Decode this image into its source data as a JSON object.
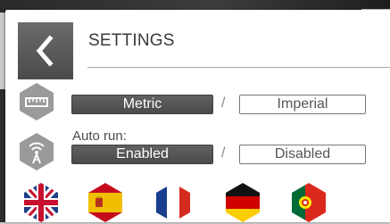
{
  "header": {
    "title": "SETTINGS",
    "back_icon": "chevron-left-icon"
  },
  "units": {
    "icon": "ruler-icon",
    "options": [
      "Metric",
      "Imperial"
    ],
    "selected": "Metric",
    "separator": "/"
  },
  "autorun": {
    "icon": "antenna-icon",
    "label": "Auto run:",
    "options": [
      "Enabled",
      "Disabled"
    ],
    "selected": "Enabled",
    "separator": "/"
  },
  "languages": [
    {
      "icon": "uk-flag-icon"
    },
    {
      "icon": "spain-flag-icon"
    },
    {
      "icon": "france-flag-icon"
    },
    {
      "icon": "germany-flag-icon"
    },
    {
      "icon": "portugal-flag-icon"
    }
  ],
  "colors": {
    "selected_fill": "#555555",
    "panel": "#ffffff",
    "icon_gray": "#9a9a9a"
  }
}
